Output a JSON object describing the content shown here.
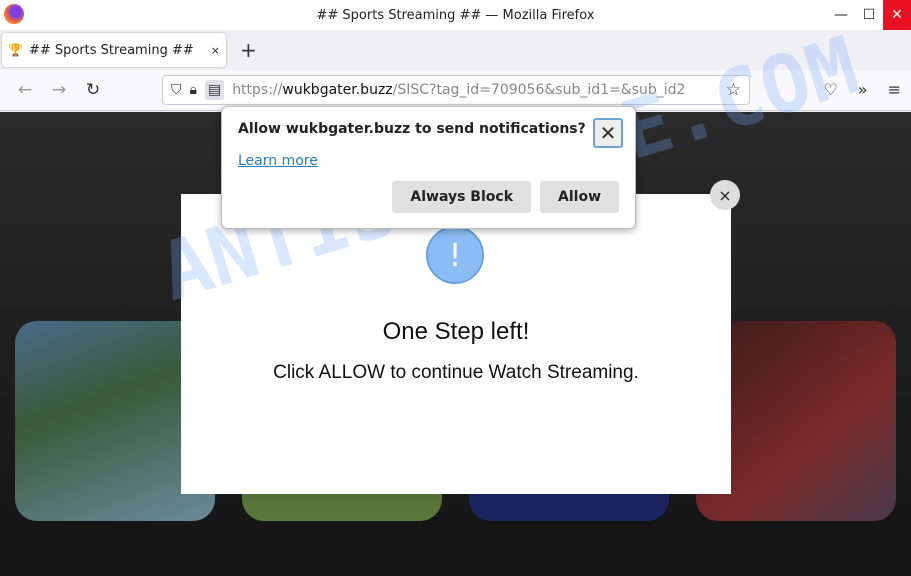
{
  "window": {
    "title": "## Sports Streaming ## — Mozilla Firefox",
    "minimize": "—",
    "maximize": "☐",
    "close": "✕"
  },
  "tab": {
    "icon": "🏆",
    "label": "## Sports Streaming ##",
    "close": "×",
    "new_tab": "+"
  },
  "nav": {
    "back": "←",
    "forward": "→",
    "reload": "↻",
    "url_scheme": "https://",
    "url_domain": "wukbgater.buzz",
    "url_path": "/SISC?tag_id=709056&sub_id1=&sub_id2",
    "star": "☆",
    "pocket": "♡",
    "overflow": "»",
    "menu": "≡"
  },
  "popup": {
    "title": "Allow wukbgater.buzz to send notifications?",
    "close": "✕",
    "learn_more": "Learn more",
    "block": "Always Block",
    "allow": "Allow"
  },
  "modal": {
    "icon": "!",
    "title": "One Step left!",
    "subtitle": "Click ALLOW to continue Watch Streaming.",
    "close": "×"
  },
  "watermark": "ANTISPYWARE.COM"
}
